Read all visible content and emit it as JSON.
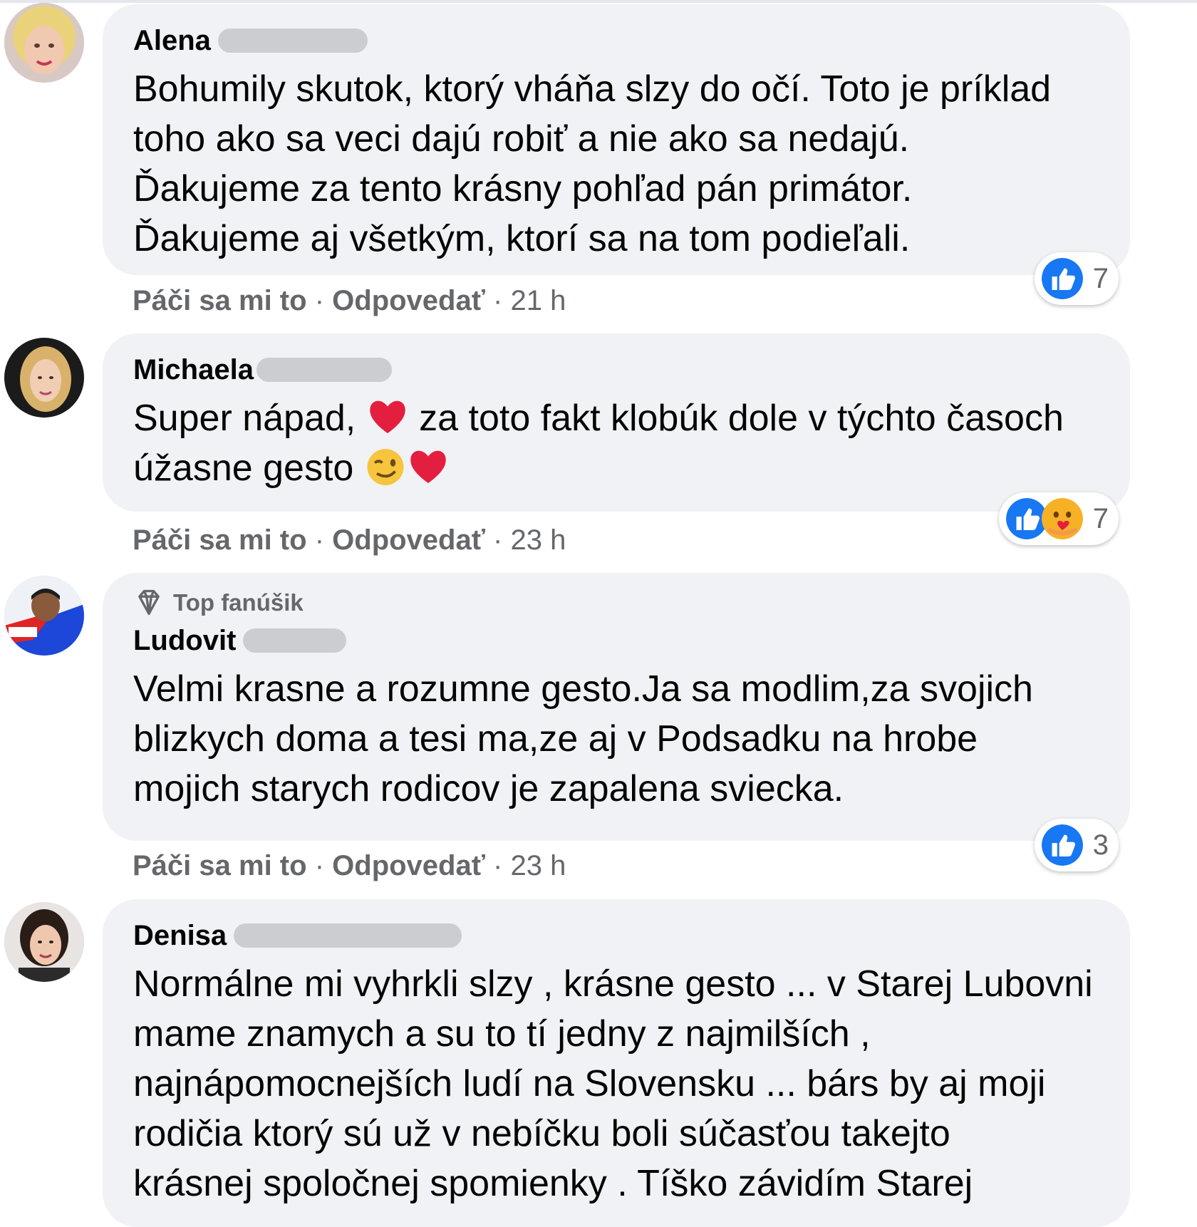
{
  "colors": {
    "like_blue": "#1877f2",
    "bubble_bg": "#f0f2f5",
    "meta_gray": "#65676b",
    "heart_red": "#e41e3f"
  },
  "comments": [
    {
      "author": "Alena",
      "text": "Bohumily skutok, ktorý vháňa slzy do očí. Toto je príklad\ntoho ako sa veci dajú robiť a nie ako sa nedajú.\nĎakujeme za tento krásny pohľad pán primátor.\nĎakujeme aj všetkým, ktorí sa na tom podieľali.",
      "reaction_icons": [
        "like-icon"
      ],
      "reaction_count": "7",
      "like_label": "Páči sa mi to",
      "separator": "·",
      "reply_label": "Odpovedať",
      "time": "21 h"
    },
    {
      "author": "Michaela",
      "text_parts": [
        "Super nápad, ",
        " za toto fakt klobúk dole v týchto časoch\núžasne gesto "
      ],
      "reaction_icons": [
        "like-icon",
        "care-icon"
      ],
      "reaction_count": "7",
      "like_label": "Páči sa mi to",
      "separator": "·",
      "reply_label": "Odpovedať",
      "time": "23 h"
    },
    {
      "badge": "Top fanúšik",
      "author": "Ludovit",
      "text": "Velmi krasne a rozumne gesto.Ja sa modlim,za svojich\nblizkych doma a tesi ma,ze aj v Podsadku na hrobe\nmojich starych rodicov je zapalena sviecka.",
      "reaction_icons": [
        "like-icon"
      ],
      "reaction_count": "3",
      "like_label": "Páči sa mi to",
      "separator": "·",
      "reply_label": "Odpovedať",
      "time": "23 h"
    },
    {
      "author": "Denisa",
      "text": "Normálne mi vyhrkli slzy , krásne gesto ... v Starej Lubovni\nmame znamych a su to tí jedny z najmilších ,\nnajnápomocnejších ludí na Slovensku ... bárs by aj moji\nrodičia ktorý sú už v nebíčku boli súčasťou takejto\nkrásnej spoločnej spomienky . Tíško závidím Starej"
    }
  ]
}
